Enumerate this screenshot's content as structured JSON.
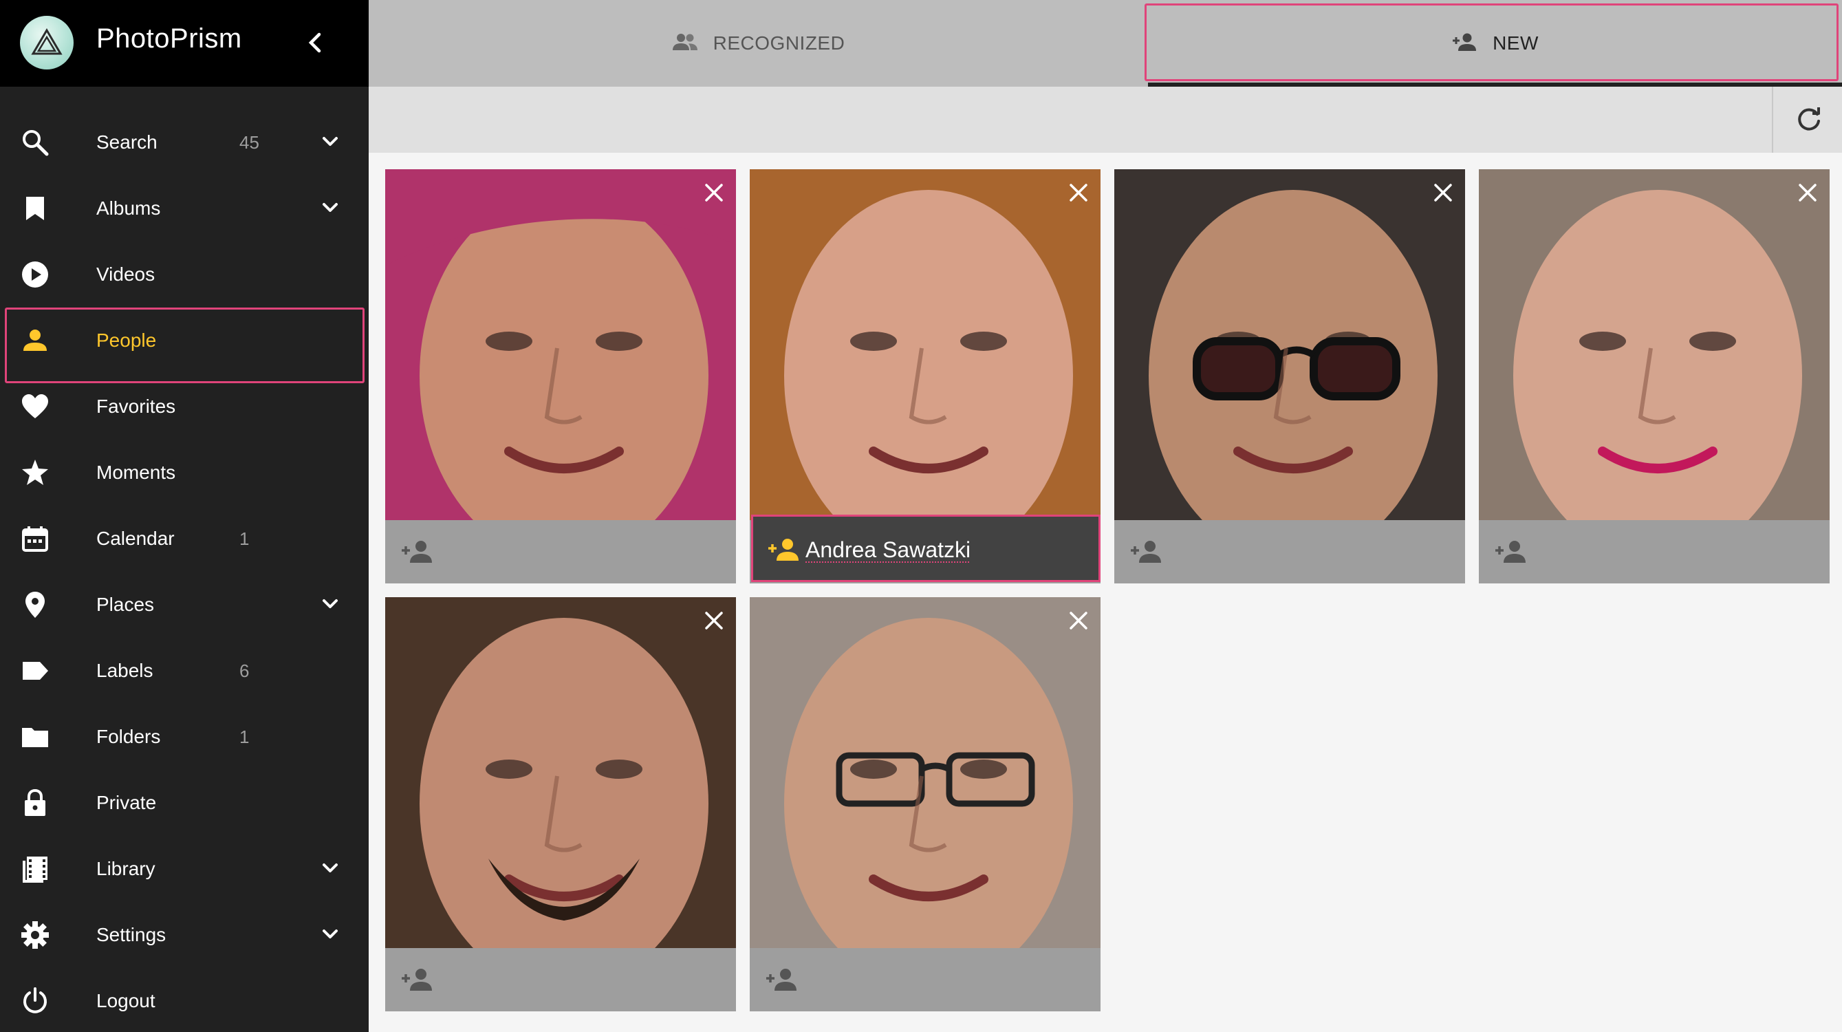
{
  "app": {
    "title": "PhotoPrism"
  },
  "sidebar": {
    "items": [
      {
        "label": "Search",
        "count": "45",
        "icon": "search-icon",
        "expandable": true
      },
      {
        "label": "Albums",
        "count": "",
        "icon": "bookmark-icon",
        "expandable": true
      },
      {
        "label": "Videos",
        "count": "",
        "icon": "play-circle-icon",
        "expandable": false
      },
      {
        "label": "People",
        "count": "",
        "icon": "person-icon",
        "expandable": false,
        "active": true
      },
      {
        "label": "Favorites",
        "count": "",
        "icon": "heart-icon",
        "expandable": false
      },
      {
        "label": "Moments",
        "count": "",
        "icon": "star-icon",
        "expandable": false
      },
      {
        "label": "Calendar",
        "count": "1",
        "icon": "calendar-icon",
        "expandable": false
      },
      {
        "label": "Places",
        "count": "",
        "icon": "place-pin-icon",
        "expandable": true
      },
      {
        "label": "Labels",
        "count": "6",
        "icon": "label-icon",
        "expandable": false
      },
      {
        "label": "Folders",
        "count": "1",
        "icon": "folder-icon",
        "expandable": false
      },
      {
        "label": "Private",
        "count": "",
        "icon": "lock-icon",
        "expandable": false
      },
      {
        "label": "Library",
        "count": "",
        "icon": "film-library-icon",
        "expandable": true
      },
      {
        "label": "Settings",
        "count": "",
        "icon": "gear-icon",
        "expandable": true
      },
      {
        "label": "Logout",
        "count": "",
        "icon": "power-icon",
        "expandable": false
      }
    ]
  },
  "tabs": [
    {
      "label": "RECOGNIZED",
      "icon": "people-icon"
    },
    {
      "label": "NEW",
      "icon": "person-add-icon",
      "active": true
    }
  ],
  "faces": [
    {
      "name": "",
      "skin": "#c98c72",
      "hair": "#b0336a"
    },
    {
      "name": "Andrea Sawatzki",
      "skin": "#d7a088",
      "hair": "#a8652e"
    },
    {
      "name": "",
      "skin": "#b98a6e",
      "hair": "#3a3330"
    },
    {
      "name": "",
      "skin": "#d4a48e",
      "hair": "#8a7a6e"
    },
    {
      "name": "",
      "skin": "#c08a72",
      "hair": "#4a3528"
    },
    {
      "name": "",
      "skin": "#c89a80",
      "hair": "#9a8e86"
    }
  ],
  "colors": {
    "accent": "#ffc72c",
    "highlight": "#e0447a",
    "sidebar": "#212121"
  }
}
